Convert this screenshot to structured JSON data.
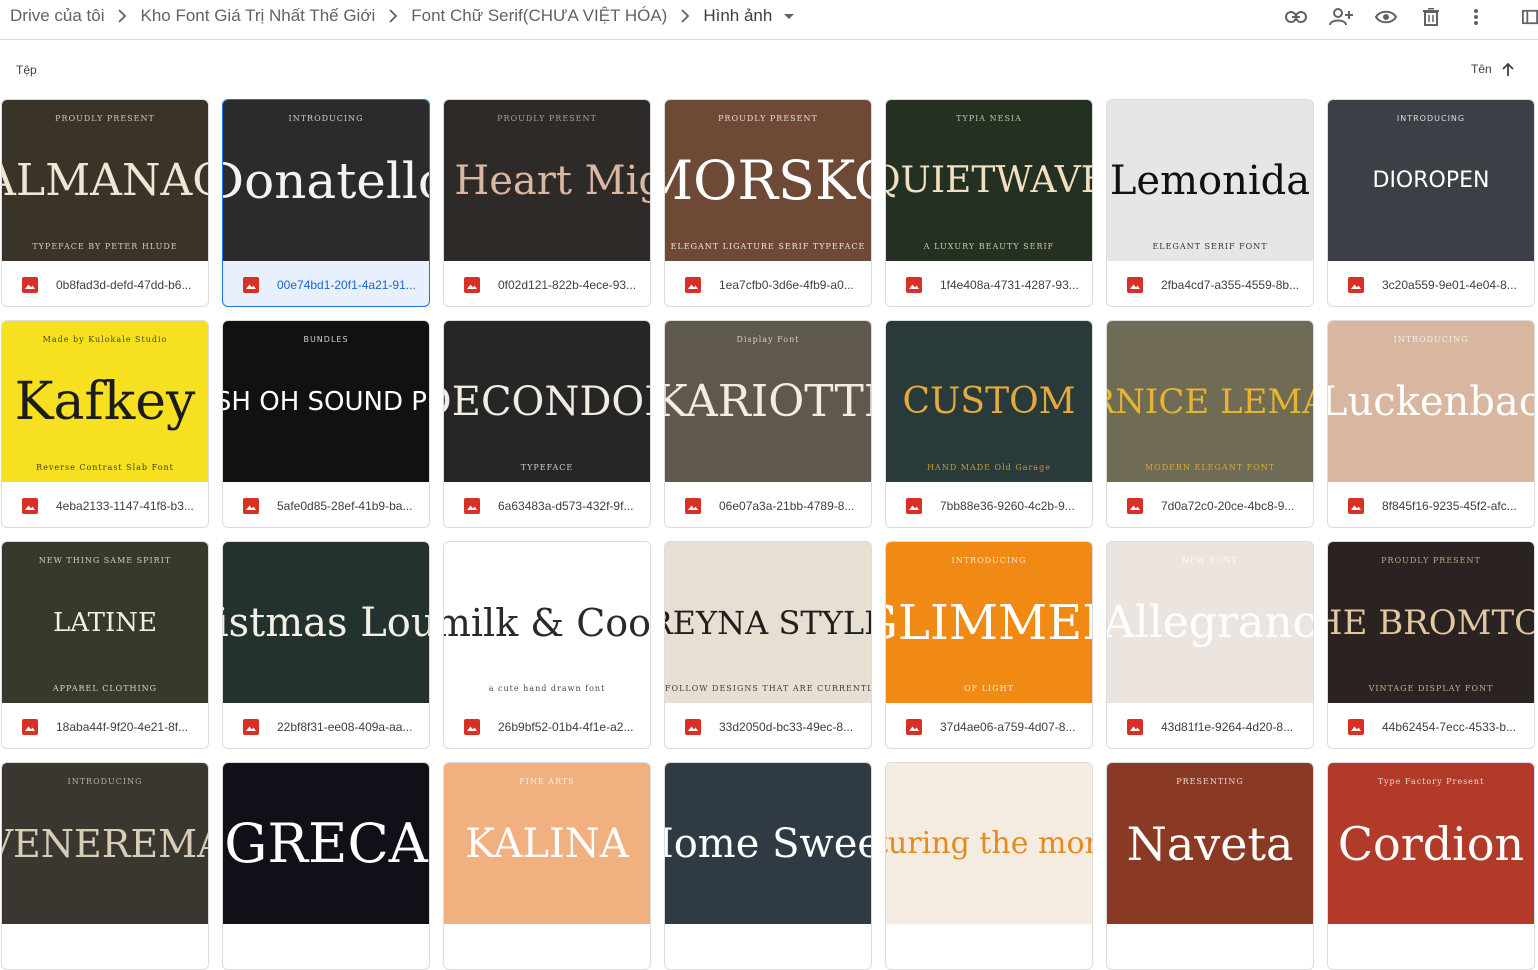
{
  "breadcrumb": {
    "items": [
      "Drive của tôi",
      "Kho Font Giá Trị Nhất Thế Giới",
      "Font Chữ Serif(CHƯA VIỆT HÓA)",
      "Hình ảnh"
    ]
  },
  "toolbar": {
    "actions": [
      "link-icon",
      "share-person-add-icon",
      "preview-eye-icon",
      "trash-icon",
      "more-vert-icon",
      "details-panel-icon"
    ]
  },
  "list_header": {
    "files_label": "Tệp",
    "sort_label": "Tên",
    "sort_direction": "ascending"
  },
  "colors": {
    "accent": "#1a73e8",
    "image_icon": "#d93025",
    "border": "#dadce0"
  },
  "files": [
    {
      "name": "0b8fad3d-defd-47dd-b6...",
      "title": "ALMANAC",
      "top": "PROUDLY PRESENT",
      "bottom": "TYPEFACE BY PETER HLUDE",
      "bg": "#3a3328",
      "fg": "#efe6d4",
      "font": "serif",
      "size": 44,
      "selected": false
    },
    {
      "name": "00e74bd1-20f1-4a21-91...",
      "title": "Donatello",
      "top": "INTRODUCING",
      "bottom": "",
      "bg": "#2b2b2d",
      "fg": "#f3f3f3",
      "font": "serif",
      "size": 50,
      "selected": true
    },
    {
      "name": "0f02d121-822b-4ece-93...",
      "title": "The Heart Mighty",
      "top": "PROUDLY PRESENT",
      "bottom": "",
      "bg": "#2e2a28",
      "fg": "#d9b7a3",
      "font": "serif",
      "size": 40,
      "selected": false
    },
    {
      "name": "1ea7cfb0-3d6e-4fb9-a0...",
      "title": "MORSKO",
      "top": "PROUDLY PRESENT",
      "bottom": "ELEGANT LIGATURE SERIF TYPEFACE",
      "bg": "#6e4a36",
      "fg": "#ffffff",
      "font": "serif",
      "size": 54,
      "selected": false
    },
    {
      "name": "1f4e408a-4731-4287-93...",
      "title": "QUIETWAVE",
      "top": "TYPIA NESIA",
      "bottom": "A LUXURY BEAUTY SERIF",
      "bg": "#243022",
      "fg": "#f1dfc0",
      "font": "serif",
      "size": 36,
      "selected": false
    },
    {
      "name": "2fba4cd7-a355-4559-8b...",
      "title": "Lemonida",
      "top": "",
      "bottom": "ELEGANT SERIF FONT",
      "bg": "#e6e6e6",
      "fg": "#111111",
      "font": "serif",
      "size": 40,
      "selected": false
    },
    {
      "name": "3c20a559-9e01-4e04-8...",
      "title": "DIOROPEN",
      "top": "INTRODUCING",
      "bottom": "",
      "bg": "#3c4046",
      "fg": "#ffffff",
      "font": "sans",
      "size": 22,
      "selected": false
    },
    {
      "name": "4eba2133-1147-41f8-b3...",
      "title": "Kafkey",
      "top": "Made by Kulokale Studio",
      "bottom": "Reverse Contrast Slab Font",
      "bg": "#f6e01f",
      "fg": "#1c1c1c",
      "font": "serif",
      "size": 52,
      "selected": false
    },
    {
      "name": "5afe0d85-28ef-41b9-ba...",
      "title": "FRESH OH SOUND PHOH",
      "top": "BUNDLES",
      "bottom": "",
      "bg": "#111111",
      "fg": "#ffffff",
      "font": "sans",
      "size": 26,
      "selected": false
    },
    {
      "name": "6a63483a-d573-432f-9f...",
      "title": "DECONDOR",
      "top": "",
      "bottom": "TYPEFACE",
      "bg": "#262626",
      "fg": "#f2ece3",
      "font": "serif",
      "size": 40,
      "selected": false
    },
    {
      "name": "06e07a3a-21bb-4789-8...",
      "title": "KARIOTTI",
      "top": "Display Font",
      "bottom": "",
      "bg": "#5f584c",
      "fg": "#f2ece3",
      "font": "serif",
      "size": 44,
      "selected": false
    },
    {
      "name": "7bb88e36-9260-4c2b-9...",
      "title": "CUSTOM",
      "top": "",
      "bottom": "HAND MADE Old Garage",
      "bg": "#283a3a",
      "fg": "#e6a93c",
      "font": "serif",
      "size": 36,
      "selected": false
    },
    {
      "name": "7d0a72c0-20ce-4bc8-9...",
      "title": "VERNICE LEMANS",
      "top": "",
      "bottom": "MODERN ELEGANT FONT",
      "bg": "#6f6b55",
      "fg": "#e6b431",
      "font": "serif",
      "size": 34,
      "selected": false
    },
    {
      "name": "8f845f16-9235-45f2-afc...",
      "title": "Luckenbac",
      "top": "INTRODUCING",
      "bottom": "",
      "bg": "#d8b6a0",
      "fg": "#ffffff",
      "font": "serif",
      "size": 40,
      "selected": false
    },
    {
      "name": "18aba44f-9f20-4e21-8f...",
      "title": "LATINE",
      "top": "NEW THING SAME SPIRIT",
      "bottom": "APPAREL CLOTHING",
      "bg": "#353a2b",
      "fg": "#f5efe2",
      "font": "serif",
      "size": 26,
      "selected": false
    },
    {
      "name": "22bf8f31-ee08-409a-aa...",
      "title": "Christmas Lounge",
      "top": "",
      "bottom": "",
      "bg": "#23322f",
      "fg": "#f5eee2",
      "font": "serif",
      "size": 40,
      "selected": false
    },
    {
      "name": "26b9bf52-01b4-4f1e-a2...",
      "title": "Oatmilk & Cookies",
      "top": "",
      "bottom": "a cute hand drawn font",
      "bg": "#ffffff",
      "fg": "#2a2a2a",
      "font": "serif",
      "size": 38,
      "selected": false
    },
    {
      "name": "33d2050d-bc33-49ec-8...",
      "title": "REYNA STYLE",
      "top": "",
      "bottom": "FOLLOW DESIGNS THAT ARE CURRENTLY POPULAR",
      "bg": "#e7dfd1",
      "fg": "#1f1f1f",
      "font": "serif",
      "size": 32,
      "selected": false
    },
    {
      "name": "37d4ae06-a759-4d07-8...",
      "title": "GLIMMER",
      "top": "INTRODUCING",
      "bottom": "OF LIGHT",
      "bg": "#f08a14",
      "fg": "#ffffff",
      "font": "serif",
      "size": 48,
      "selected": false
    },
    {
      "name": "43d81f1e-9264-4d20-8...",
      "title": "Allegranc",
      "top": "NEW FONT",
      "bottom": "",
      "bg": "#ece5df",
      "fg": "#ffffff",
      "font": "serif",
      "size": 44,
      "selected": false
    },
    {
      "name": "44b62454-7ecc-4533-b...",
      "title": "THE BROMTON",
      "top": "PROUDLY PRESENT",
      "bottom": "VINTAGE DISPLAY FONT",
      "bg": "#2a2321",
      "fg": "#e2c79f",
      "font": "serif",
      "size": 34,
      "selected": false
    },
    {
      "name": "",
      "title": "VENEREMA",
      "top": "INTRODUCING",
      "bottom": "",
      "bg": "#3a3630",
      "fg": "#d9cdb5",
      "font": "serif",
      "size": 38,
      "selected": false
    },
    {
      "name": "",
      "title": "GRECA",
      "top": "",
      "bottom": "",
      "bg": "#101018",
      "fg": "#ffffff",
      "font": "serif",
      "size": 54,
      "selected": false
    },
    {
      "name": "",
      "title": "KALINA",
      "top": "FINE ARTS",
      "bottom": "",
      "bg": "#f1b07f",
      "fg": "#ffffff",
      "font": "serif",
      "size": 40,
      "selected": false
    },
    {
      "name": "",
      "title": "Home Sweet",
      "top": "",
      "bottom": "",
      "bg": "#2f3a44",
      "fg": "#ffffff",
      "font": "serif",
      "size": 40,
      "selected": false
    },
    {
      "name": "",
      "title": "Capturing the moment",
      "top": "",
      "bottom": "",
      "bg": "#f4ece0",
      "fg": "#e38b1f",
      "font": "serif",
      "size": 30,
      "selected": false
    },
    {
      "name": "",
      "title": "Naveta",
      "top": "PRESENTING",
      "bottom": "",
      "bg": "#8a3a24",
      "fg": "#ffffff",
      "font": "serif",
      "size": 46,
      "selected": false
    },
    {
      "name": "",
      "title": "Cordion",
      "top": "Type Factory Present",
      "bottom": "",
      "bg": "#b23a28",
      "fg": "#ffffff",
      "font": "serif",
      "size": 46,
      "selected": false
    }
  ]
}
